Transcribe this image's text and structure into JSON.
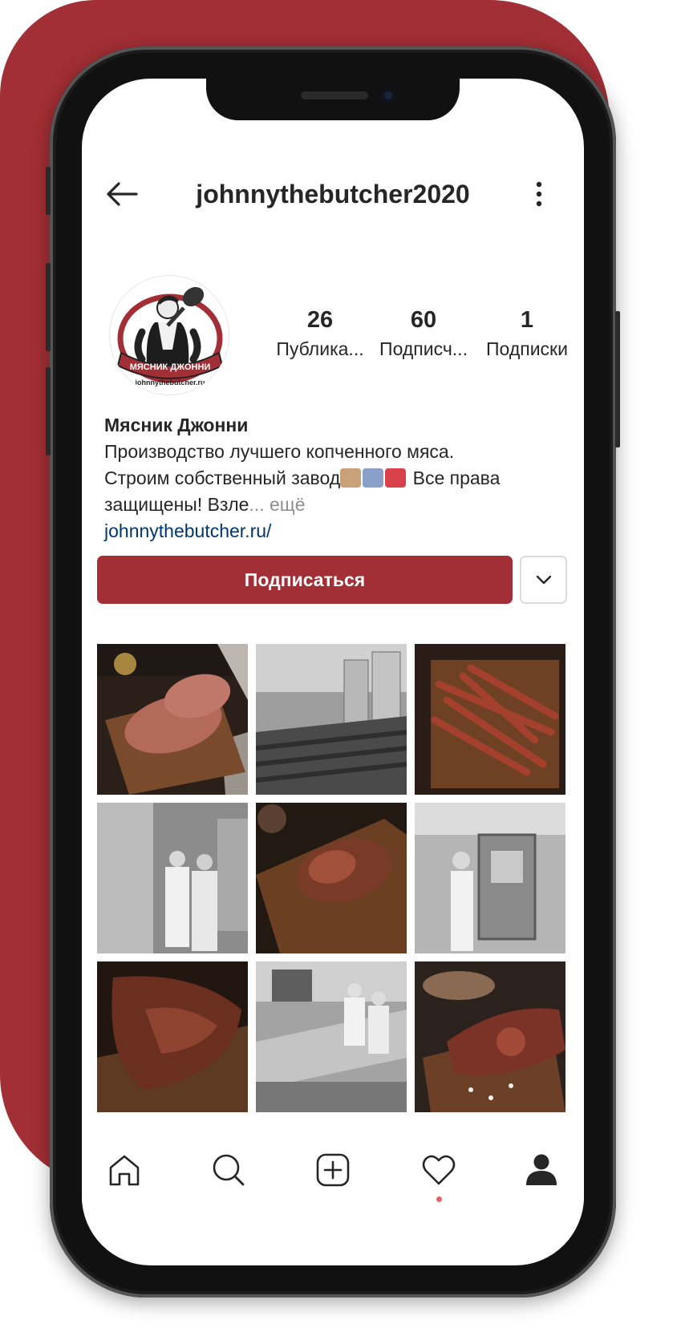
{
  "app": {
    "colors": {
      "brand": "#a22f35",
      "text": "#262626",
      "muted": "#8e8e8e",
      "link": "#00376b",
      "notification_dot": "#e2636b"
    }
  },
  "header": {
    "username": "johnnythebutcher2020",
    "back_icon": "arrow-left-icon",
    "more_icon": "vertical-dots-icon"
  },
  "profile": {
    "avatar": {
      "logo_text": "МЯСНИК ДЖОННИ",
      "logo_url_text": "johnnythebutcher.ru"
    },
    "stats": [
      {
        "count": "26",
        "label": "Публика..."
      },
      {
        "count": "60",
        "label": "Подписч..."
      },
      {
        "count": "1",
        "label": "Подписки"
      }
    ],
    "bio": {
      "name": "Мясник Джонни",
      "line1": "Производство лучшего копченного мяса.",
      "line2_before_emoji": "Строим собственный завод",
      "line2_after_emoji": " Все права",
      "line3": "защищены! Взле",
      "more": "... ещё",
      "link": "johnnythebutcher.ru/"
    },
    "follow_label": "Подписаться",
    "dropdown_icon": "chevron-down-icon"
  },
  "grid": {
    "posts": [
      {
        "subject": "pork loin on wooden board"
      },
      {
        "subject": "sausage conveyor in factory"
      },
      {
        "subject": "meat jerky sticks on board"
      },
      {
        "subject": "workers by steel tanks"
      },
      {
        "subject": "smoked ham on cutting board"
      },
      {
        "subject": "worker at packaging machine"
      },
      {
        "subject": "smoked pork knuckle on board"
      },
      {
        "subject": "workers at production line"
      },
      {
        "subject": "ham with coarse salt"
      }
    ]
  },
  "bottom_nav": {
    "items": [
      {
        "icon": "home-icon"
      },
      {
        "icon": "search-icon"
      },
      {
        "icon": "add-post-icon"
      },
      {
        "icon": "heart-icon"
      },
      {
        "icon": "profile-icon"
      }
    ]
  }
}
